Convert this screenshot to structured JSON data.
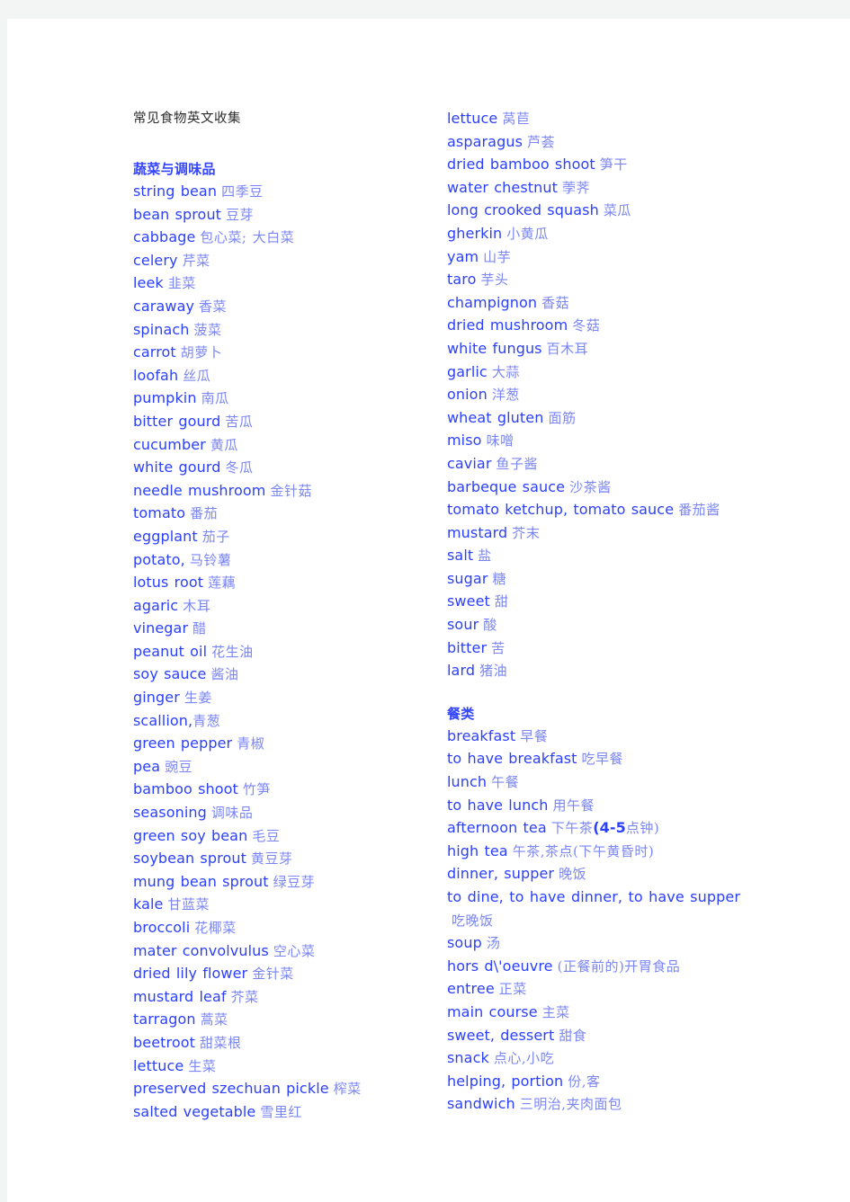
{
  "document": {
    "title": "常见食物英文收集"
  },
  "columns": {
    "left": {
      "section": "蔬菜与调味品",
      "entries": [
        {
          "en": "string bean",
          "cn": "四季豆"
        },
        {
          "en": "bean sprout",
          "cn": "豆芽"
        },
        {
          "en": "cabbage",
          "cn": "包心菜; 大白菜"
        },
        {
          "en": "celery",
          "cn": "芹菜"
        },
        {
          "en": "leek",
          "cn": "韭菜"
        },
        {
          "en": "caraway",
          "cn": "香菜"
        },
        {
          "en": "spinach",
          "cn": "菠菜"
        },
        {
          "en": "carrot",
          "cn": "胡萝卜"
        },
        {
          "en": "loofah",
          "cn": "丝瓜"
        },
        {
          "en": "pumpkin",
          "cn": "南瓜"
        },
        {
          "en": "bitter gourd",
          "cn": "苦瓜"
        },
        {
          "en": "cucumber",
          "cn": "黄瓜"
        },
        {
          "en": "white gourd",
          "cn": "冬瓜"
        },
        {
          "en": "needle mushroom",
          "cn": "金针菇"
        },
        {
          "en": "tomato",
          "cn": "番茄"
        },
        {
          "en": "eggplant",
          "cn": "茄子"
        },
        {
          "en": "potato,",
          "cn": "马铃薯"
        },
        {
          "en": "lotus root",
          "cn": "莲藕"
        },
        {
          "en": "agaric",
          "cn": "木耳"
        },
        {
          "en": "vinegar",
          "cn": "醋"
        },
        {
          "en": "peanut oil",
          "cn": "花生油"
        },
        {
          "en": "soy sauce",
          "cn": "酱油"
        },
        {
          "en": "ginger",
          "cn": "生姜"
        },
        {
          "en": "scallion,",
          "cn": "青葱",
          "nospace": true
        },
        {
          "en": "green pepper",
          "cn": "青椒"
        },
        {
          "en": "pea",
          "cn": "豌豆"
        },
        {
          "en": "bamboo shoot",
          "cn": "竹笋"
        },
        {
          "en": "seasoning",
          "cn": "调味品"
        },
        {
          "en": "green soy bean",
          "cn": "毛豆"
        },
        {
          "en": "soybean sprout",
          "cn": "黄豆芽"
        },
        {
          "en": "mung bean sprout",
          "cn": "绿豆芽"
        },
        {
          "en": "kale",
          "cn": "甘蓝菜"
        },
        {
          "en": "broccoli",
          "cn": "花椰菜"
        },
        {
          "en": "mater convolvulus",
          "cn": "空心菜"
        },
        {
          "en": "dried lily flower",
          "cn": "金针菜"
        },
        {
          "en": "mustard leaf",
          "cn": "芥菜"
        },
        {
          "en": "tarragon",
          "cn": "蒿菜"
        },
        {
          "en": "beetroot",
          "cn": "甜菜根"
        },
        {
          "en": "lettuce",
          "cn": "生菜"
        },
        {
          "en": "preserved szechuan pickle",
          "cn": "榨菜"
        },
        {
          "en": "salted vegetable",
          "cn": "雪里红"
        }
      ]
    },
    "right": {
      "entries_top": [
        {
          "en": "lettuce",
          "cn": "莴苣"
        },
        {
          "en": "asparagus",
          "cn": "芦荟"
        },
        {
          "en": "dried bamboo shoot",
          "cn": "笋干"
        },
        {
          "en": "water chestnut",
          "cn": "荸荠"
        },
        {
          "en": "long crooked squash",
          "cn": "菜瓜"
        },
        {
          "en": "gherkin",
          "cn": "小黄瓜"
        },
        {
          "en": "yam",
          "cn": "山芋"
        },
        {
          "en": "taro",
          "cn": "芋头"
        },
        {
          "en": "champignon",
          "cn": "香菇"
        },
        {
          "en": "dried mushroom",
          "cn": "冬菇"
        },
        {
          "en": "white fungus",
          "cn": "百木耳"
        },
        {
          "en": "garlic",
          "cn": "大蒜"
        },
        {
          "en": "onion",
          "cn": "洋葱"
        },
        {
          "en": "wheat gluten",
          "cn": "面筋"
        },
        {
          "en": "miso",
          "cn": "味噌"
        },
        {
          "en": "caviar",
          "cn": "鱼子酱"
        },
        {
          "en": "barbeque sauce",
          "cn": "沙茶酱"
        },
        {
          "en": "tomato ketchup, tomato sauce",
          "cn": "番茄酱",
          "wrap": true
        },
        {
          "en": "mustard",
          "cn": "芥末"
        },
        {
          "en": "salt",
          "cn": "盐"
        },
        {
          "en": "sugar",
          "cn": "糖"
        },
        {
          "en": "sweet",
          "cn": "甜"
        },
        {
          "en": "sour",
          "cn": "酸"
        },
        {
          "en": "bitter",
          "cn": "苦"
        },
        {
          "en": "lard",
          "cn": "猪油"
        }
      ],
      "section": "餐类",
      "entries_meals": [
        {
          "en": "breakfast",
          "cn": "早餐"
        },
        {
          "en": "to have breakfast",
          "cn": "吃早餐"
        },
        {
          "en": "lunch",
          "cn": "午餐"
        },
        {
          "en": "to have lunch",
          "cn": "用午餐"
        },
        {
          "en": "afternoon tea",
          "cn": "下午茶",
          "cn_bold": "(4-5",
          "cn_tail": "点钟)"
        },
        {
          "en": "high tea",
          "cn": "午茶,茶点(下午黄昏时)"
        },
        {
          "en": "dinner, supper",
          "cn": "晚饭"
        },
        {
          "en": "to dine, to have dinner, to have supper",
          "cn": "吃晚饭",
          "wrap": true
        },
        {
          "en": "soup",
          "cn": "汤"
        },
        {
          "en": "hors d\\'oeuvre",
          "cn": "(正餐前的)开胃食品"
        },
        {
          "en": "entree",
          "cn": "正菜"
        },
        {
          "en": "main course",
          "cn": "主菜"
        },
        {
          "en": "sweet, dessert",
          "cn": "甜食"
        },
        {
          "en": "snack",
          "cn": "点心,小吃"
        },
        {
          "en": "helping, portion",
          "cn": "份,客"
        },
        {
          "en": "sandwich",
          "cn": "三明治,夹肉面包"
        }
      ]
    }
  },
  "colors": {
    "english": "#2b3fff",
    "chinese": "#7b86f5",
    "heading": "#3344ff",
    "title": "#2b2b2b",
    "page_background": "#ffffff",
    "canvas_background": "#f3f4f4"
  }
}
